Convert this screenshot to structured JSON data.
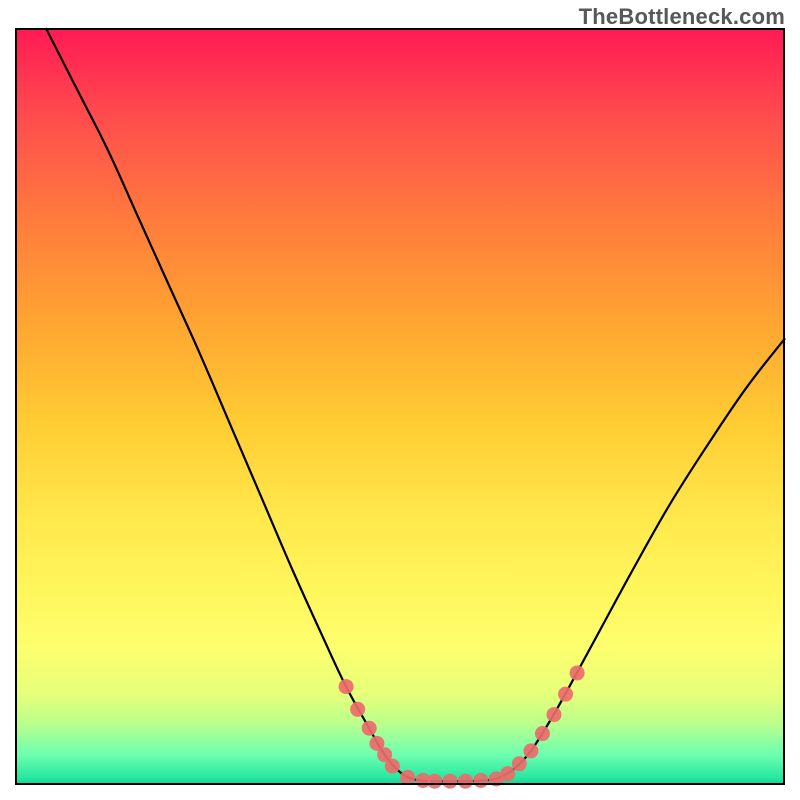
{
  "attribution": "TheBottleneck.com",
  "chart_data": {
    "type": "line",
    "title": "",
    "xlabel": "",
    "ylabel": "",
    "xlim": [
      0,
      100
    ],
    "ylim": [
      0,
      100
    ],
    "curve_points": [
      {
        "x": 4.0,
        "y": 100.0
      },
      {
        "x": 8.0,
        "y": 92.0
      },
      {
        "x": 12.0,
        "y": 84.0
      },
      {
        "x": 16.0,
        "y": 75.0
      },
      {
        "x": 20.0,
        "y": 66.0
      },
      {
        "x": 24.0,
        "y": 57.0
      },
      {
        "x": 28.0,
        "y": 47.5
      },
      {
        "x": 32.0,
        "y": 38.0
      },
      {
        "x": 36.0,
        "y": 28.5
      },
      {
        "x": 40.0,
        "y": 19.5
      },
      {
        "x": 43.0,
        "y": 13.0
      },
      {
        "x": 46.0,
        "y": 7.5
      },
      {
        "x": 48.0,
        "y": 4.0
      },
      {
        "x": 50.0,
        "y": 1.7
      },
      {
        "x": 52.0,
        "y": 0.7
      },
      {
        "x": 55.0,
        "y": 0.5
      },
      {
        "x": 58.0,
        "y": 0.5
      },
      {
        "x": 61.0,
        "y": 0.6
      },
      {
        "x": 63.0,
        "y": 1.0
      },
      {
        "x": 65.0,
        "y": 2.3
      },
      {
        "x": 67.0,
        "y": 4.5
      },
      {
        "x": 69.5,
        "y": 8.5
      },
      {
        "x": 72.0,
        "y": 13.0
      },
      {
        "x": 76.0,
        "y": 20.5
      },
      {
        "x": 80.0,
        "y": 28.0
      },
      {
        "x": 85.0,
        "y": 37.0
      },
      {
        "x": 90.0,
        "y": 45.0
      },
      {
        "x": 95.0,
        "y": 52.5
      },
      {
        "x": 100.0,
        "y": 59.0
      }
    ],
    "markers": [
      {
        "x": 43.0,
        "y": 13.0
      },
      {
        "x": 44.5,
        "y": 10.0
      },
      {
        "x": 46.0,
        "y": 7.5
      },
      {
        "x": 47.0,
        "y": 5.5
      },
      {
        "x": 48.0,
        "y": 4.0
      },
      {
        "x": 49.0,
        "y": 2.5
      },
      {
        "x": 51.0,
        "y": 1.0
      },
      {
        "x": 53.0,
        "y": 0.6
      },
      {
        "x": 54.5,
        "y": 0.5
      },
      {
        "x": 56.5,
        "y": 0.5
      },
      {
        "x": 58.5,
        "y": 0.5
      },
      {
        "x": 60.5,
        "y": 0.6
      },
      {
        "x": 62.5,
        "y": 0.8
      },
      {
        "x": 64.0,
        "y": 1.5
      },
      {
        "x": 65.5,
        "y": 2.8
      },
      {
        "x": 67.0,
        "y": 4.5
      },
      {
        "x": 68.5,
        "y": 6.8
      },
      {
        "x": 70.0,
        "y": 9.3
      },
      {
        "x": 71.5,
        "y": 12.0
      },
      {
        "x": 73.0,
        "y": 14.8
      }
    ],
    "marker_color": "#ec6b6b",
    "background_gradient": {
      "top": "#ff1a55",
      "bottom": "#1dc997"
    }
  }
}
